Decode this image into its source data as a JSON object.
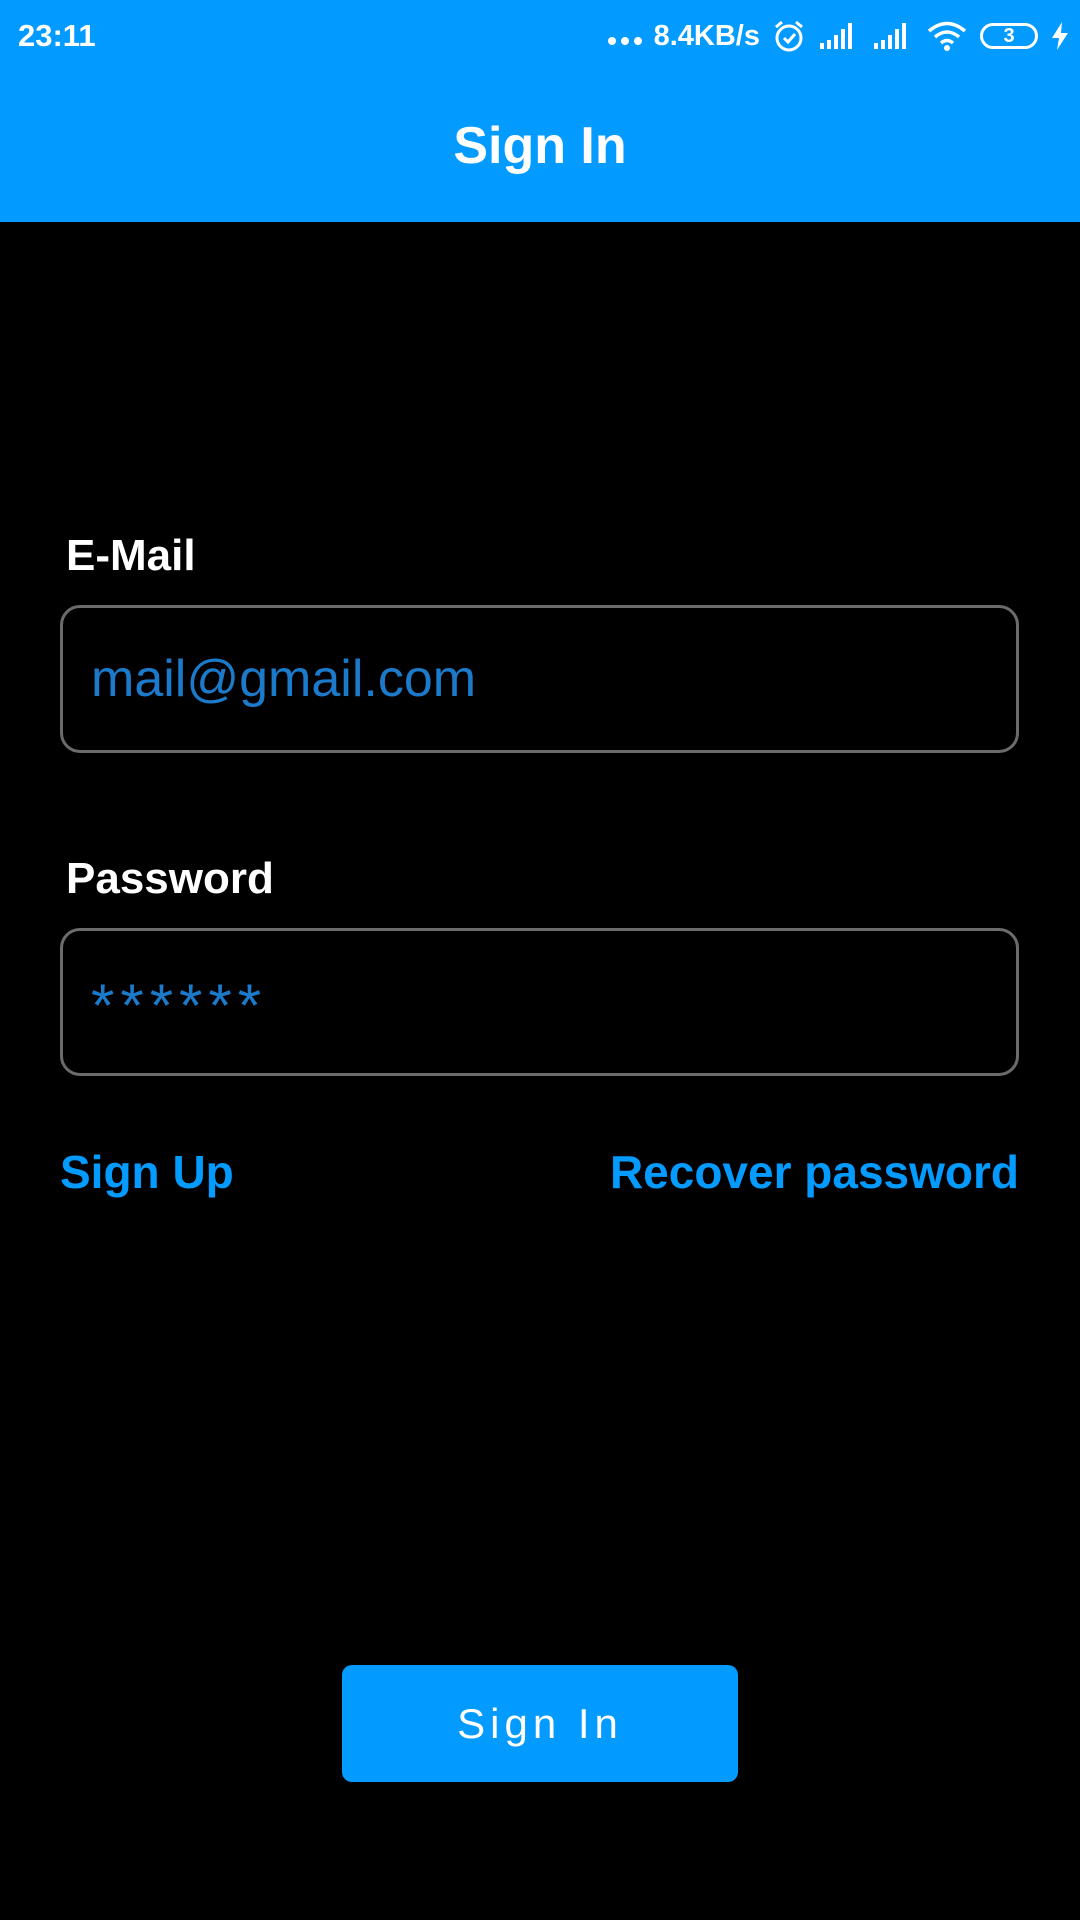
{
  "status_bar": {
    "time": "23:11",
    "net_speed": "8.4KB/s",
    "battery_level": "3",
    "icons": [
      "more-dots-icon",
      "alarm-icon",
      "signal-icon",
      "signal-icon",
      "wifi-icon",
      "battery-icon",
      "charging-icon"
    ]
  },
  "header": {
    "title": "Sign In"
  },
  "form": {
    "email_label": "E-Mail",
    "email_value": "mail@gmail.com",
    "password_label": "Password",
    "password_value": "******"
  },
  "links": {
    "sign_up": "Sign Up",
    "recover_password": "Recover password"
  },
  "button": {
    "sign_in_label": "Sign In"
  },
  "colors": {
    "accent": "#039BFF",
    "input_text": "#1C7ACB",
    "background": "#000000",
    "field_border": "#6B6B6B"
  }
}
